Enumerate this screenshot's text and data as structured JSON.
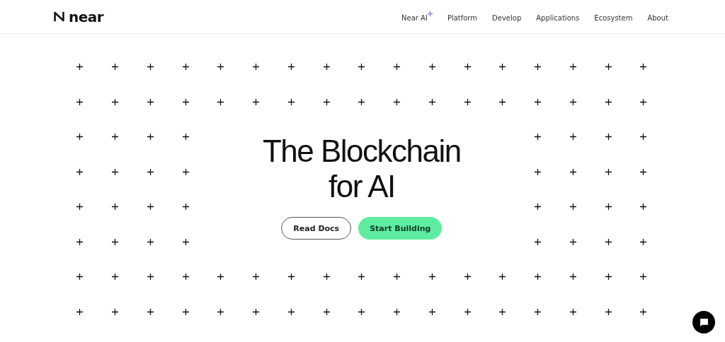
{
  "header": {
    "logo": "near",
    "nav": [
      {
        "label": "Near AI",
        "sparkle": true
      },
      {
        "label": "Platform",
        "sparkle": false
      },
      {
        "label": "Develop",
        "sparkle": false
      },
      {
        "label": "Applications",
        "sparkle": false
      },
      {
        "label": "Ecosystem",
        "sparkle": false
      },
      {
        "label": "About",
        "sparkle": false
      }
    ]
  },
  "hero": {
    "title_lines": [
      "The Blockchain",
      "for AI"
    ],
    "buttons": [
      {
        "label": "Read Docs",
        "kind": "outline"
      },
      {
        "label": "Start Building",
        "kind": "primary"
      }
    ]
  }
}
